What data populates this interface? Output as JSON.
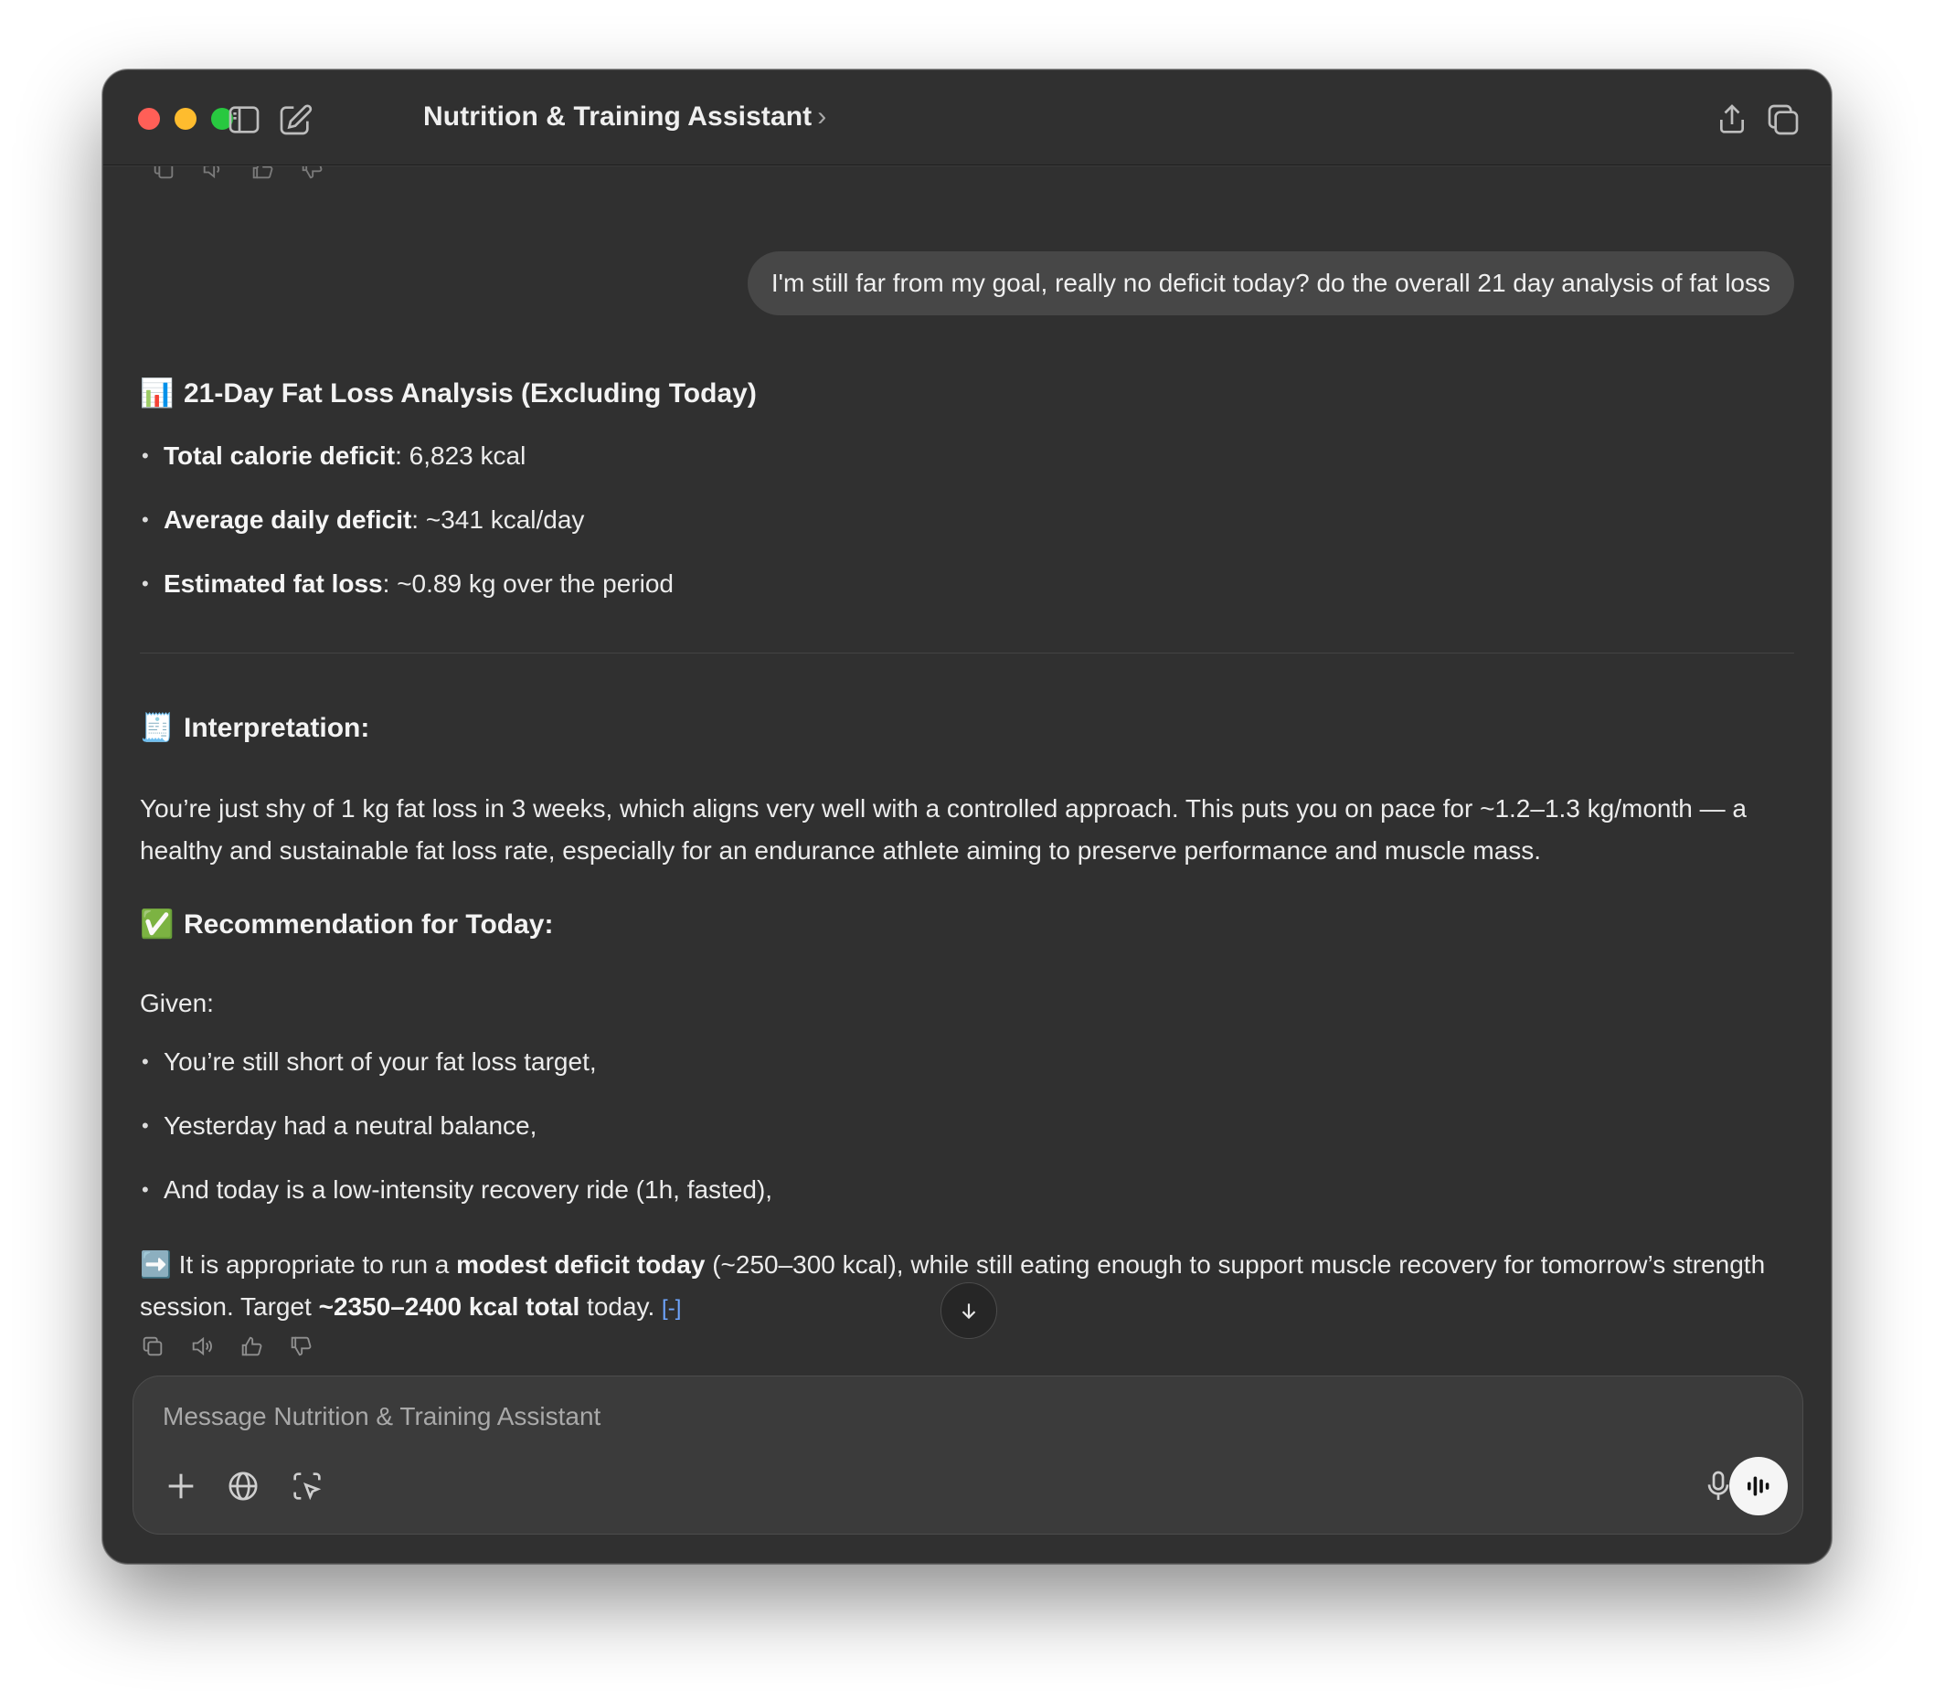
{
  "window": {
    "title": "Nutrition & Training Assistant",
    "title_chevron": "›"
  },
  "conversation": {
    "user_message": "I'm still far from my goal, really no deficit today? do the overall 21 day analysis of fat loss",
    "analysis": {
      "emoji": "📊",
      "heading": "21-Day Fat Loss Analysis (Excluding Today)",
      "items": [
        {
          "label": "Total calorie deficit",
          "value": ": 6,823 kcal"
        },
        {
          "label": "Average daily deficit",
          "value": ": ~341 kcal/day"
        },
        {
          "label": "Estimated fat loss",
          "value": ": ~0.89 kg over the period"
        }
      ]
    },
    "interpretation": {
      "emoji": "🧾",
      "heading": "Interpretation:",
      "text": "You’re just shy of 1 kg fat loss in 3 weeks, which aligns very well with a controlled approach. This puts you on pace for ~1.2–1.3 kg/month — a healthy and sustainable fat loss rate, especially for an endurance athlete aiming to preserve performance and muscle mass."
    },
    "recommendation": {
      "emoji": "✅",
      "heading": "Recommendation for Today:",
      "given_label": "Given:",
      "given_items": [
        "You’re still short of your fat loss target,",
        "Yesterday had a neutral balance,",
        "And today is a low-intensity recovery ride (1h, fasted),"
      ],
      "arrow_emoji": "➡️",
      "conclusion_pre": " It is appropriate to run a ",
      "conclusion_bold1": "modest deficit today",
      "conclusion_mid": " (~250–300 kcal), while still eating enough to support muscle recovery for tomorrow’s strength session. Target ",
      "conclusion_bold2": "~2350–2400 kcal total",
      "conclusion_post": " today.",
      "source_pill": "[-]"
    }
  },
  "composer": {
    "placeholder": "Message Nutrition & Training Assistant"
  },
  "colors": {
    "window_bg": "#303030",
    "bubble_bg": "#474747",
    "composer_bg": "#3b3b3b",
    "accent_link": "#6fa6ff"
  },
  "icons": [
    "sidebar-toggle-icon",
    "new-chat-icon",
    "share-icon",
    "new-window-icon",
    "copy-icon",
    "read-aloud-icon",
    "thumbs-up-icon",
    "thumbs-down-icon",
    "arrow-down-icon",
    "plus-icon",
    "globe-icon",
    "screen-select-icon",
    "microphone-icon",
    "voice-mode-icon"
  ]
}
